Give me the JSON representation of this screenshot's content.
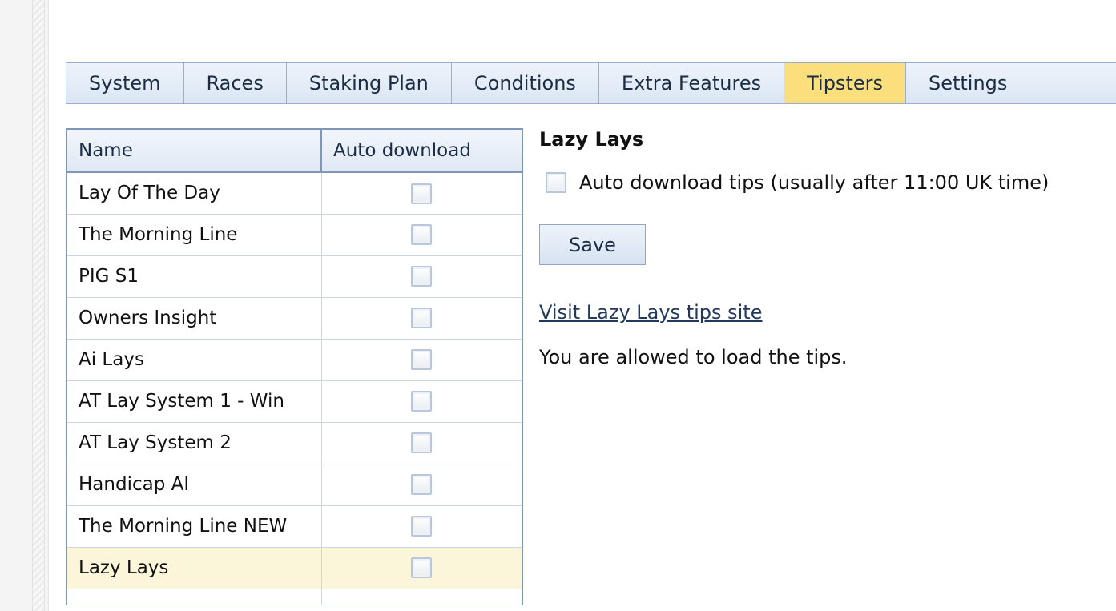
{
  "tabs": [
    {
      "label": "System",
      "active": false
    },
    {
      "label": "Races",
      "active": false
    },
    {
      "label": "Staking Plan",
      "active": false
    },
    {
      "label": "Conditions",
      "active": false
    },
    {
      "label": "Extra Features",
      "active": false
    },
    {
      "label": "Tipsters",
      "active": true
    },
    {
      "label": "Settings",
      "active": false
    }
  ],
  "table": {
    "headers": {
      "name": "Name",
      "auto_download": "Auto download"
    },
    "rows": [
      {
        "name": "Lay Of The Day",
        "auto_download": false
      },
      {
        "name": "The Morning Line",
        "auto_download": false
      },
      {
        "name": "PIG S1",
        "auto_download": false
      },
      {
        "name": "Owners Insight",
        "auto_download": false
      },
      {
        "name": "Ai Lays",
        "auto_download": false
      },
      {
        "name": "AT Lay System 1 - Win",
        "auto_download": false
      },
      {
        "name": "AT Lay System 2",
        "auto_download": false
      },
      {
        "name": "Handicap AI",
        "auto_download": false
      },
      {
        "name": "The Morning Line NEW",
        "auto_download": false
      },
      {
        "name": "Lazy Lays",
        "auto_download": false,
        "selected": true
      }
    ]
  },
  "detail": {
    "title": "Lazy Lays",
    "auto_download_label": "Auto download tips (usually after 11:00 UK time)",
    "auto_download_checked": false,
    "save_label": "Save",
    "visit_link": "Visit Lazy Lays tips site",
    "status_text": "You are allowed to load the tips."
  },
  "colors": {
    "active_tab": "#fcdf7d",
    "selected_row": "#fbf6da",
    "tab_border": "#9aafcd"
  }
}
